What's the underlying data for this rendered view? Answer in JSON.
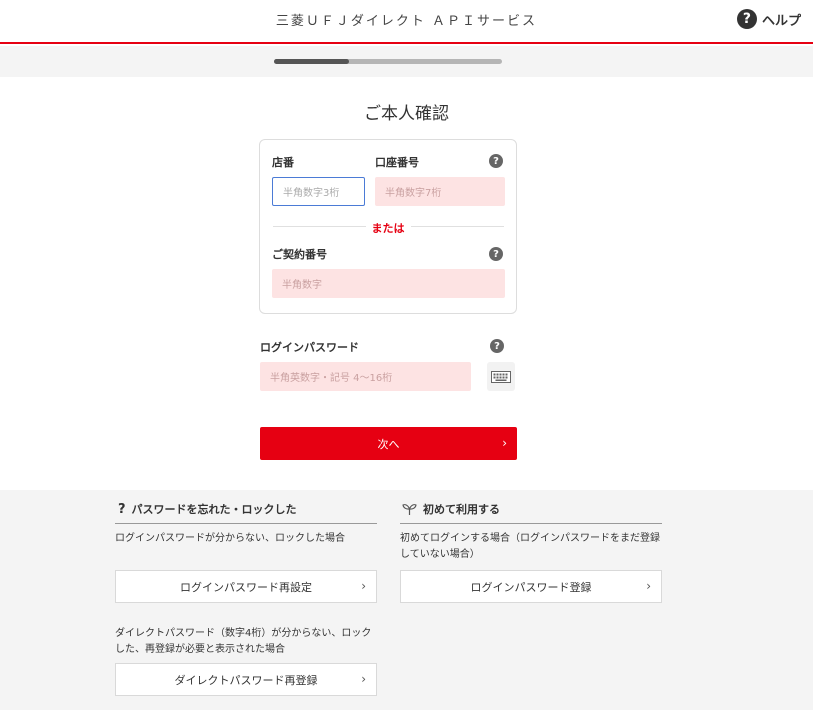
{
  "header": {
    "title": "三菱ＵＦＪダイレクト ＡＰＩサービス",
    "help_label": "ヘルプ",
    "help_icon": "?"
  },
  "progress": {
    "fraction": 0.33
  },
  "page_title": "ご本人確認",
  "form": {
    "branch": {
      "label": "店番",
      "placeholder": "半角数字3桁"
    },
    "account": {
      "label": "口座番号",
      "placeholder": "半角数字7桁"
    },
    "or_label": "または",
    "contract": {
      "label": "ご契約番号",
      "placeholder": "半角数字"
    },
    "password": {
      "label": "ログインパスワード",
      "placeholder": "半角英数字・記号 4〜16桁"
    },
    "help_icon": "?",
    "next_label": "次へ",
    "next_chevron": "›"
  },
  "footer": {
    "forgot": {
      "icon": "?",
      "heading": "パスワードを忘れた・ロックした",
      "desc1": "ログインパスワードが分からない、ロックした場合",
      "button1": "ログインパスワード再設定",
      "desc2_line1": "ダイレクトパスワード（数字4桁）が分からない、ロック",
      "desc2_line2": "した、再登録が必要と表示された場合",
      "button2": "ダイレクトパスワード再登録"
    },
    "first": {
      "heading": "初めて利用する",
      "desc_line1": "初めてログインする場合（ログインパスワードをまだ登録",
      "desc_line2": "していない場合）",
      "button": "ログインパスワード登録"
    },
    "chevron": "›"
  },
  "colors": {
    "brand_red": "#e60012",
    "input_pink": "#fde3e3"
  }
}
